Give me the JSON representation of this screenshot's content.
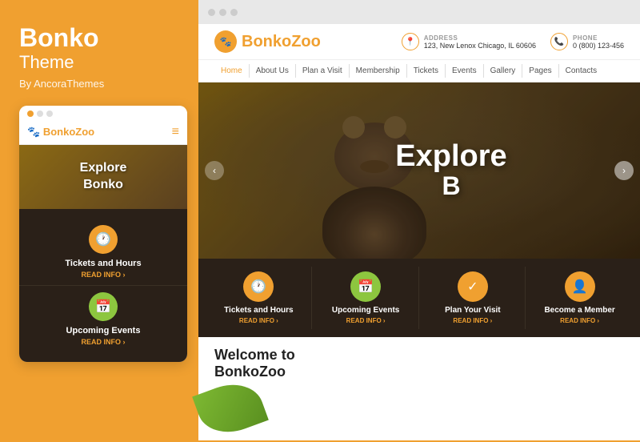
{
  "left": {
    "title": "Bonko",
    "subtitle": "Theme",
    "by": "By AncoraThemes",
    "mobile": {
      "dots": [
        "dot1",
        "dot2",
        "dot3"
      ],
      "logo": "BonkoZoo",
      "logo_accent": "Zoo",
      "hero_line1": "Explore",
      "hero_line2": "Bonko",
      "features": [
        {
          "icon": "🕐",
          "bg": "#f0a030",
          "title": "Tickets and Hours",
          "read": "READ INFO"
        },
        {
          "icon": "📅",
          "bg": "#8dc63f",
          "title": "Upcoming Events",
          "read": "READ INFO"
        }
      ]
    }
  },
  "desktop": {
    "logo": "BonkoZoo",
    "logo_accent": "Zoo",
    "address_label": "ADDRESS",
    "address_value": "123, New Lenox Chicago, IL 60606",
    "phone_label": "PHONE",
    "phone_value": "0 (800) 123-456",
    "nav": [
      "Home",
      "About Us",
      "Plan a Visit",
      "Membership",
      "Tickets",
      "Events",
      "Gallery",
      "Pages",
      "Contacts"
    ],
    "hero": {
      "line1": "Explore",
      "line2": "B"
    },
    "features": [
      {
        "icon": "🕐",
        "bg": "#f0a030",
        "title": "Tickets and Hours",
        "read": "READ INFO"
      },
      {
        "icon": "📅",
        "bg": "#8dc63f",
        "title": "Upcoming Events",
        "read": "READ INFO"
      },
      {
        "icon": "✓",
        "bg": "#f0a030",
        "title": "Plan Your Visit",
        "read": "READ INFO"
      },
      {
        "icon": "👤",
        "bg": "#f0a030",
        "title": "Become a Member",
        "read": "READ INFO"
      }
    ],
    "welcome_title_line1": "Welcome to",
    "welcome_title_line2": "BonkoZoo"
  }
}
